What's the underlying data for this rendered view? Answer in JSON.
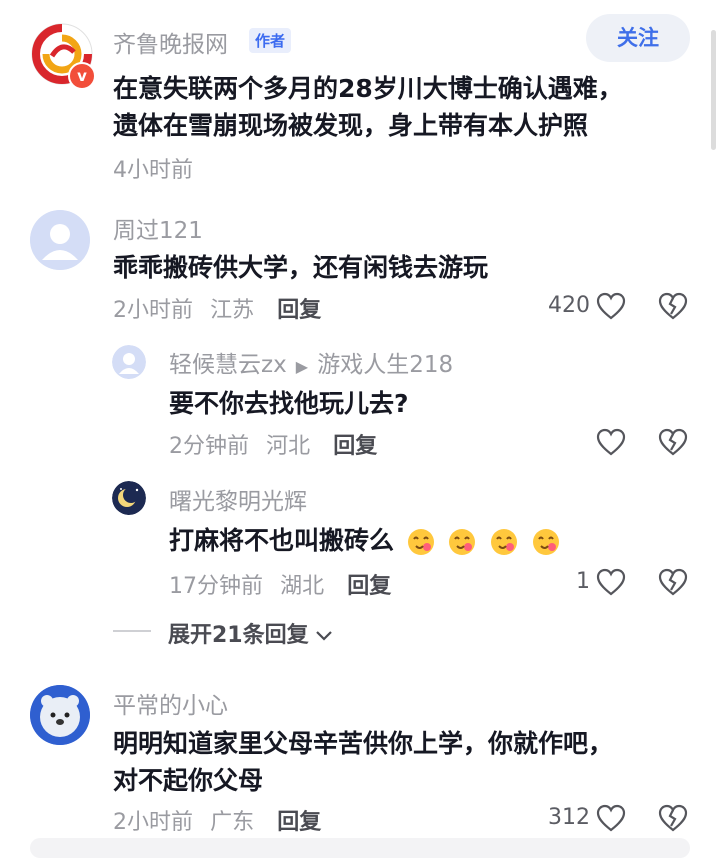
{
  "post": {
    "author": "齐鲁晚报网",
    "author_badge": "作者",
    "follow_label": "关注",
    "text_line1": "在意失联两个多月的28岁川大博士确认遇难，",
    "text_line2": "遗体在雪崩现场被发现，身上带有本人护照",
    "time": "4小时前"
  },
  "comments": [
    {
      "user": "周过121",
      "text": "乖乖搬砖供大学，还有闲钱去游玩",
      "time": "2小时前",
      "location": "江苏",
      "reply_label": "回复",
      "likes": "420",
      "replies": [
        {
          "user": "轻候慧云zx",
          "reply_to": "游戏人生218",
          "text": "要不你去找他玩儿去?",
          "time": "2分钟前",
          "location": "河北",
          "reply_label": "回复"
        },
        {
          "user": "曙光黎明光辉",
          "text": "打麻将不也叫搬砖么",
          "time": "17分钟前",
          "location": "湖北",
          "reply_label": "回复",
          "likes": "1"
        }
      ],
      "expand_label": "展开21条回复"
    },
    {
      "user": "平常的小心",
      "text_line1": "明明知道家里父母辛苦供你上学，你就作吧，",
      "text_line2": "对不起你父母",
      "time": "2小时前",
      "location": "广东",
      "reply_label": "回复",
      "likes": "312"
    }
  ],
  "colors": {
    "accent": "#3f6fe9",
    "meta_gray": "#9a9ba1",
    "text_dark": "#161823"
  }
}
